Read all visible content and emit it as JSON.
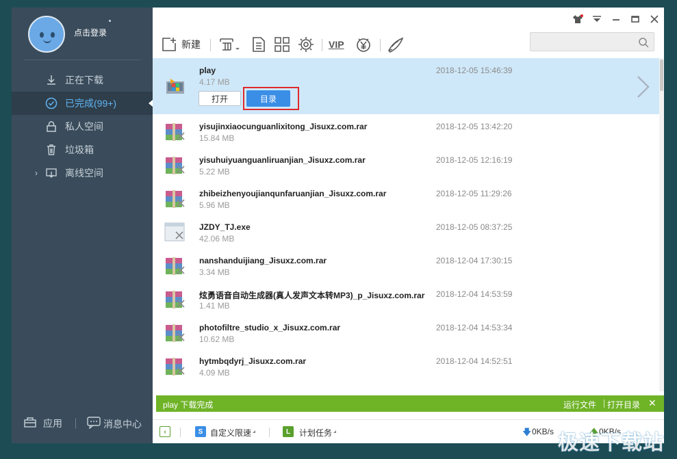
{
  "sidebar": {
    "login_label": "点击登录",
    "items": [
      {
        "label": "正在下载",
        "icon": "download-icon"
      },
      {
        "label": "已完成(99+)",
        "icon": "check-circle-icon"
      },
      {
        "label": "私人空间",
        "icon": "lock-icon"
      },
      {
        "label": "垃圾箱",
        "icon": "trash-icon"
      },
      {
        "label": "离线空间",
        "icon": "cloud-download-icon"
      }
    ],
    "apps_label": "应用",
    "messages_label": "消息中心"
  },
  "toolbar": {
    "new_label": "新建",
    "vip_label": "VIP"
  },
  "selected": {
    "name": "play",
    "size": "4.17 MB",
    "date": "2018-12-05 15:46:39",
    "open_label": "打开",
    "dir_label": "目录"
  },
  "files": [
    {
      "name": "yisujinxiaocunguanlixitong_Jisuxz.com.rar",
      "size": "15.84 MB",
      "date": "2018-12-05 13:42:20",
      "type": "rar"
    },
    {
      "name": "yisuhuiyuanguanliruanjian_Jisuxz.com.rar",
      "size": "5.22 MB",
      "date": "2018-12-05 12:16:19",
      "type": "rar"
    },
    {
      "name": "zhibeizhenyoujianqunfaruanjian_Jisuxz.com.rar",
      "size": "5.96 MB",
      "date": "2018-12-05 11:29:26",
      "type": "rar"
    },
    {
      "name": "JZDY_TJ.exe",
      "size": "42.06 MB",
      "date": "2018-12-05 08:37:25",
      "type": "exe"
    },
    {
      "name": "nanshanduijiang_Jisuxz.com.rar",
      "size": "3.34 MB",
      "date": "2018-12-04 17:30:15",
      "type": "rar"
    },
    {
      "name": "炫勇语音自动生成器(真人发声文本转MP3)_p_Jisuxz.com.rar",
      "size": "1.41 MB",
      "date": "2018-12-04 14:53:59",
      "type": "rar"
    },
    {
      "name": "photofiltre_studio_x_Jisuxz.com.rar",
      "size": "10.62 MB",
      "date": "2018-12-04 14:53:34",
      "type": "rar"
    },
    {
      "name": "hytmbqdyrj_Jisuxz.com.rar",
      "size": "4.09 MB",
      "date": "2018-12-04 14:52:51",
      "type": "rar"
    }
  ],
  "notification": {
    "text": "play 下载完成",
    "run_label": "运行文件",
    "open_dir_label": "打开目录"
  },
  "statusbar": {
    "speed_limit_label": "自定义限速",
    "schedule_label": "计划任务",
    "download_speed": "0KB/s",
    "upload_speed": "0KB/s"
  },
  "watermark": "极速下载站",
  "colors": {
    "sidebar_bg": "#3a4c5b",
    "accent_blue": "#3a8ee6",
    "selected_row": "#cfe8f9",
    "notify_green": "#6fb327",
    "highlight_red": "#e0282b"
  }
}
